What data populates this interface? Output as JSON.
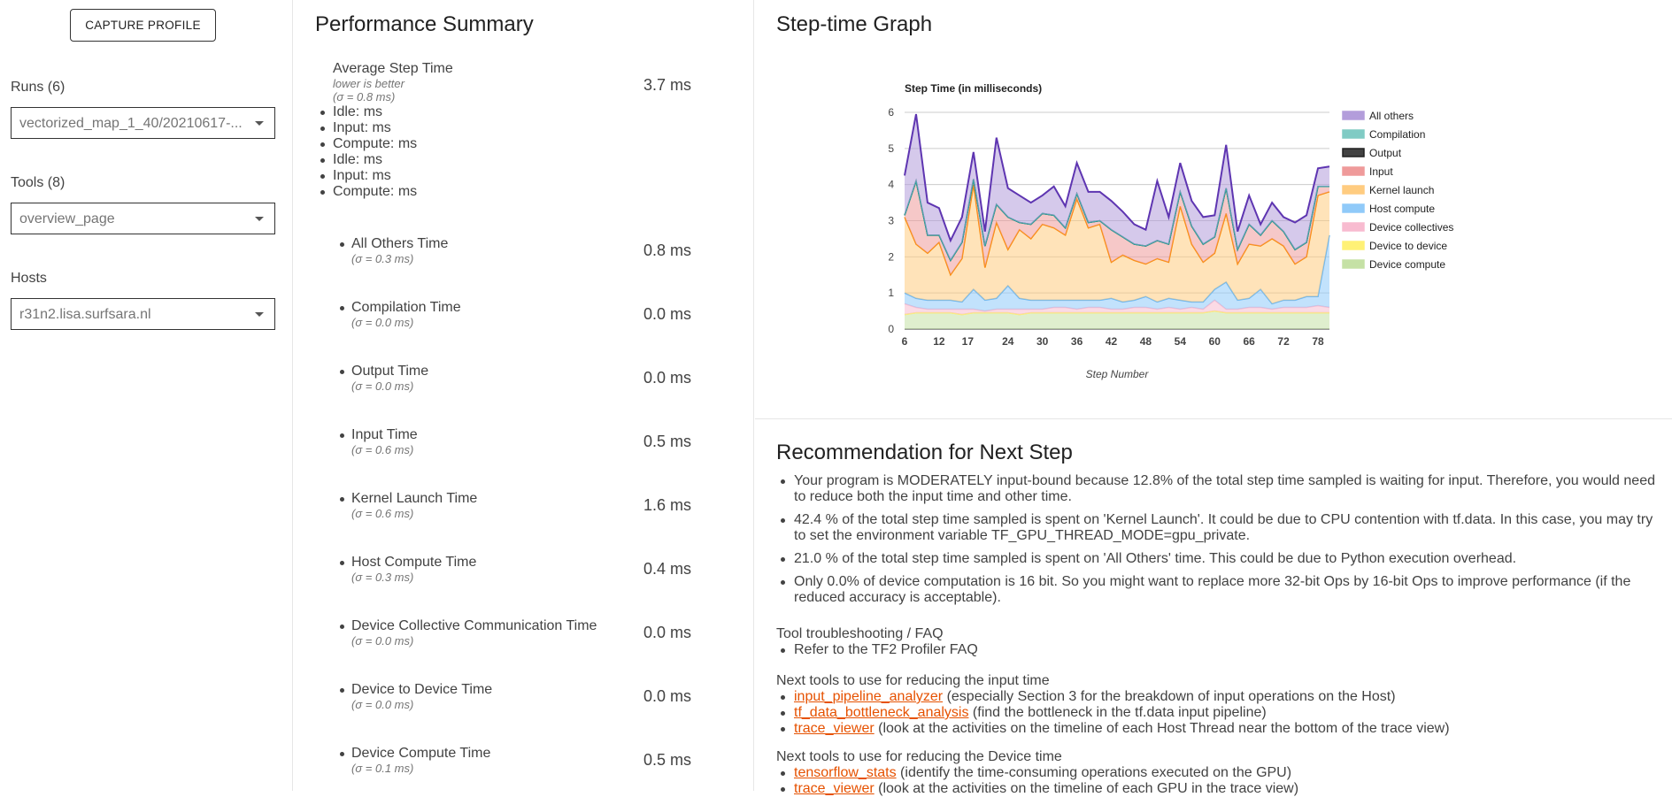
{
  "sidebar": {
    "capture_label": "CAPTURE PROFILE",
    "runs_label": "Runs (6)",
    "runs_value": "vectorized_map_1_40/20210617-...",
    "tools_label": "Tools (8)",
    "tools_value": "overview_page",
    "hosts_label": "Hosts",
    "hosts_value": "r31n2.lisa.surfsara.nl"
  },
  "summary": {
    "title": "Performance Summary",
    "avg": {
      "label": "Average Step Time",
      "note1": "lower is better",
      "note2": "(σ = 0.8 ms)",
      "value": "3.7 ms",
      "items": [
        "Idle: ms",
        "Input: ms",
        "Compute: ms",
        "Idle: ms",
        "Input: ms",
        "Compute: ms"
      ]
    },
    "metrics": [
      {
        "name": "All Others Time",
        "sigma": "(σ = 0.3 ms)",
        "value": "0.8 ms"
      },
      {
        "name": "Compilation Time",
        "sigma": "(σ = 0.0 ms)",
        "value": "0.0 ms"
      },
      {
        "name": "Output Time",
        "sigma": "(σ = 0.0 ms)",
        "value": "0.0 ms"
      },
      {
        "name": "Input Time",
        "sigma": "(σ = 0.6 ms)",
        "value": "0.5 ms"
      },
      {
        "name": "Kernel Launch Time",
        "sigma": "(σ = 0.6 ms)",
        "value": "1.6 ms"
      },
      {
        "name": "Host Compute Time",
        "sigma": "(σ = 0.3 ms)",
        "value": "0.4 ms"
      },
      {
        "name": "Device Collective Communication Time",
        "sigma": "(σ = 0.0 ms)",
        "value": "0.0 ms"
      },
      {
        "name": "Device to Device Time",
        "sigma": "(σ = 0.0 ms)",
        "value": "0.0 ms"
      },
      {
        "name": "Device Compute Time",
        "sigma": "(σ = 0.1 ms)",
        "value": "0.5 ms"
      }
    ]
  },
  "graph": {
    "title": "Step-time Graph"
  },
  "chart_data": {
    "type": "area",
    "title": "Step Time (in milliseconds)",
    "xlabel": "Step Number",
    "ylabel": "",
    "ylim": [
      0,
      6
    ],
    "xlim": [
      6,
      80
    ],
    "x_ticks": [
      "6",
      "12",
      "17",
      "24",
      "30",
      "36",
      "42",
      "48",
      "54",
      "60",
      "66",
      "72",
      "78"
    ],
    "x_tick_values": [
      6,
      12,
      17,
      24,
      30,
      36,
      42,
      48,
      54,
      60,
      66,
      72,
      78
    ],
    "y_ticks": [
      "0",
      "1",
      "2",
      "3",
      "4",
      "5",
      "6"
    ],
    "grid": true,
    "legend_position": "right",
    "stacked": true,
    "x": [
      6,
      8,
      10,
      12,
      14,
      16,
      18,
      20,
      22,
      24,
      26,
      28,
      30,
      32,
      34,
      36,
      38,
      40,
      42,
      44,
      46,
      48,
      50,
      52,
      54,
      56,
      58,
      60,
      62,
      64,
      66,
      68,
      70,
      72,
      74,
      76,
      78,
      80
    ],
    "series": [
      {
        "name": "Device compute",
        "color": "#c5e1a5",
        "values": [
          0.4,
          0.45,
          0.45,
          0.45,
          0.45,
          0.4,
          0.45,
          0.45,
          0.45,
          0.45,
          0.4,
          0.45,
          0.45,
          0.45,
          0.45,
          0.45,
          0.45,
          0.45,
          0.45,
          0.45,
          0.45,
          0.45,
          0.45,
          0.45,
          0.45,
          0.45,
          0.45,
          0.5,
          0.45,
          0.45,
          0.45,
          0.45,
          0.45,
          0.45,
          0.45,
          0.45,
          0.45,
          0.45
        ]
      },
      {
        "name": "Device to device",
        "color": "#fff176",
        "values": [
          0,
          0,
          0,
          0,
          0,
          0,
          0,
          0,
          0,
          0,
          0,
          0,
          0,
          0,
          0,
          0,
          0,
          0,
          0,
          0,
          0,
          0,
          0,
          0,
          0,
          0,
          0,
          0,
          0,
          0,
          0,
          0,
          0,
          0,
          0,
          0,
          0,
          0
        ]
      },
      {
        "name": "Device collectives",
        "color": "#f8bbd0",
        "values": [
          0.3,
          0.15,
          0.1,
          0.1,
          0.1,
          0.15,
          0.1,
          0.05,
          0.1,
          0.1,
          0.15,
          0.1,
          0.1,
          0.15,
          0.15,
          0.1,
          0.15,
          0.15,
          0.1,
          0.1,
          0.15,
          0.15,
          0.1,
          0.15,
          0.1,
          0.15,
          0.1,
          0.3,
          0.1,
          0.1,
          0.15,
          0.15,
          0.1,
          0.15,
          0.15,
          0.15,
          0.2,
          0.15
        ]
      },
      {
        "name": "Host compute",
        "color": "#90caf9",
        "values": [
          0.3,
          0.25,
          0.25,
          0.25,
          0.25,
          0.2,
          0.55,
          0.3,
          0.3,
          0.65,
          0.3,
          0.25,
          0.25,
          0.2,
          0.2,
          0.25,
          0.2,
          0.2,
          0.3,
          0.2,
          0.2,
          0.3,
          0.2,
          0.25,
          0.25,
          0.15,
          0.2,
          0.3,
          0.75,
          0.25,
          0.25,
          0.5,
          0.15,
          0.2,
          0.2,
          0.3,
          0.25,
          2.0
        ]
      },
      {
        "name": "Kernel launch",
        "color": "#ffcc80",
        "values": [
          2.1,
          1.5,
          1.3,
          1.6,
          0.7,
          1.2,
          2.9,
          0.9,
          2.1,
          1.0,
          1.9,
          1.7,
          2.1,
          2.0,
          1.8,
          2.8,
          2.0,
          2.1,
          1.0,
          1.3,
          1.1,
          0.9,
          1.2,
          1.0,
          2.6,
          1.6,
          1.1,
          1.0,
          1.9,
          1.0,
          1.5,
          1.2,
          1.8,
          1.5,
          1.0,
          1.1,
          2.8,
          1.2
        ]
      },
      {
        "name": "Input",
        "color": "#ef9a9a",
        "values": [
          0.05,
          1.75,
          0.5,
          0.2,
          0.4,
          0.45,
          0.15,
          0.6,
          0.5,
          0.9,
          0.2,
          0.4,
          0.3,
          0.35,
          0.2,
          0.15,
          0.15,
          0.1,
          0.9,
          0.5,
          0.45,
          0.5,
          0.5,
          0.5,
          0.4,
          0.5,
          0.5,
          0.45,
          0.7,
          0.4,
          0.55,
          0.3,
          0.5,
          0.4,
          0.4,
          0.4,
          0.25,
          0.15
        ]
      },
      {
        "name": "Output",
        "color": "#424242",
        "values": [
          0,
          0,
          0,
          0,
          0,
          0,
          0,
          0,
          0,
          0,
          0,
          0,
          0,
          0,
          0,
          0,
          0,
          0,
          0,
          0,
          0,
          0,
          0,
          0,
          0,
          0,
          0,
          0,
          0,
          0,
          0,
          0,
          0,
          0,
          0,
          0,
          0,
          0
        ]
      },
      {
        "name": "Compilation",
        "color": "#80cbc4",
        "values": [
          0,
          0,
          0,
          0,
          0,
          0,
          0,
          0,
          0,
          0,
          0,
          0,
          0,
          0,
          0,
          0,
          0,
          0,
          0,
          0,
          0,
          0,
          0,
          0,
          0,
          0,
          0,
          0,
          0,
          0,
          0,
          0,
          0,
          0,
          0,
          0,
          0,
          0
        ]
      },
      {
        "name": "All others",
        "color": "#b39ddb",
        "values": [
          1.1,
          1.85,
          0.9,
          0.75,
          0.55,
          0.7,
          0.75,
          0.4,
          1.85,
          0.8,
          0.75,
          0.6,
          0.5,
          0.8,
          0.6,
          0.85,
          0.85,
          0.8,
          0.8,
          0.7,
          0.55,
          0.45,
          1.65,
          0.75,
          0.8,
          0.7,
          0.75,
          0.6,
          1.2,
          0.5,
          0.8,
          0.3,
          0.5,
          0.4,
          0.75,
          0.75,
          0.5,
          0.55
        ]
      }
    ]
  },
  "recommendation": {
    "title": "Recommendation for Next Step",
    "items": [
      "Your program is MODERATELY input-bound because 12.8% of the total step time sampled is waiting for input. Therefore, you would need to reduce both the input time and other time.",
      "42.4 % of the total step time sampled is spent on 'Kernel Launch'. It could be due to CPU contention with tf.data. In this case, you may try to set the environment variable TF_GPU_THREAD_MODE=gpu_private.",
      "21.0 % of the total step time sampled is spent on 'All Others' time. This could be due to Python execution overhead.",
      "Only 0.0% of device computation is 16 bit. So you might want to replace more 32-bit Ops by 16-bit Ops to improve performance (if the reduced accuracy is acceptable)."
    ],
    "faq_heading": "Tool troubleshooting / FAQ",
    "faq_item": "Refer to the TF2 Profiler FAQ",
    "input_heading": "Next tools to use for reducing the input time",
    "input_tools": [
      {
        "link": "input_pipeline_analyzer",
        "desc": " (especially Section 3 for the breakdown of input operations on the Host)"
      },
      {
        "link": "tf_data_bottleneck_analysis",
        "desc": " (find the bottleneck in the tf.data input pipeline)"
      },
      {
        "link": "trace_viewer",
        "desc": " (look at the activities on the timeline of each Host Thread near the bottom of the trace view)"
      }
    ],
    "device_heading": "Next tools to use for reducing the Device time",
    "device_tools": [
      {
        "link": "tensorflow_stats",
        "desc": " (identify the time-consuming operations executed on the GPU)"
      },
      {
        "link": "trace_viewer",
        "desc": " (look at the activities on the timeline of each GPU in the trace view)"
      }
    ]
  }
}
